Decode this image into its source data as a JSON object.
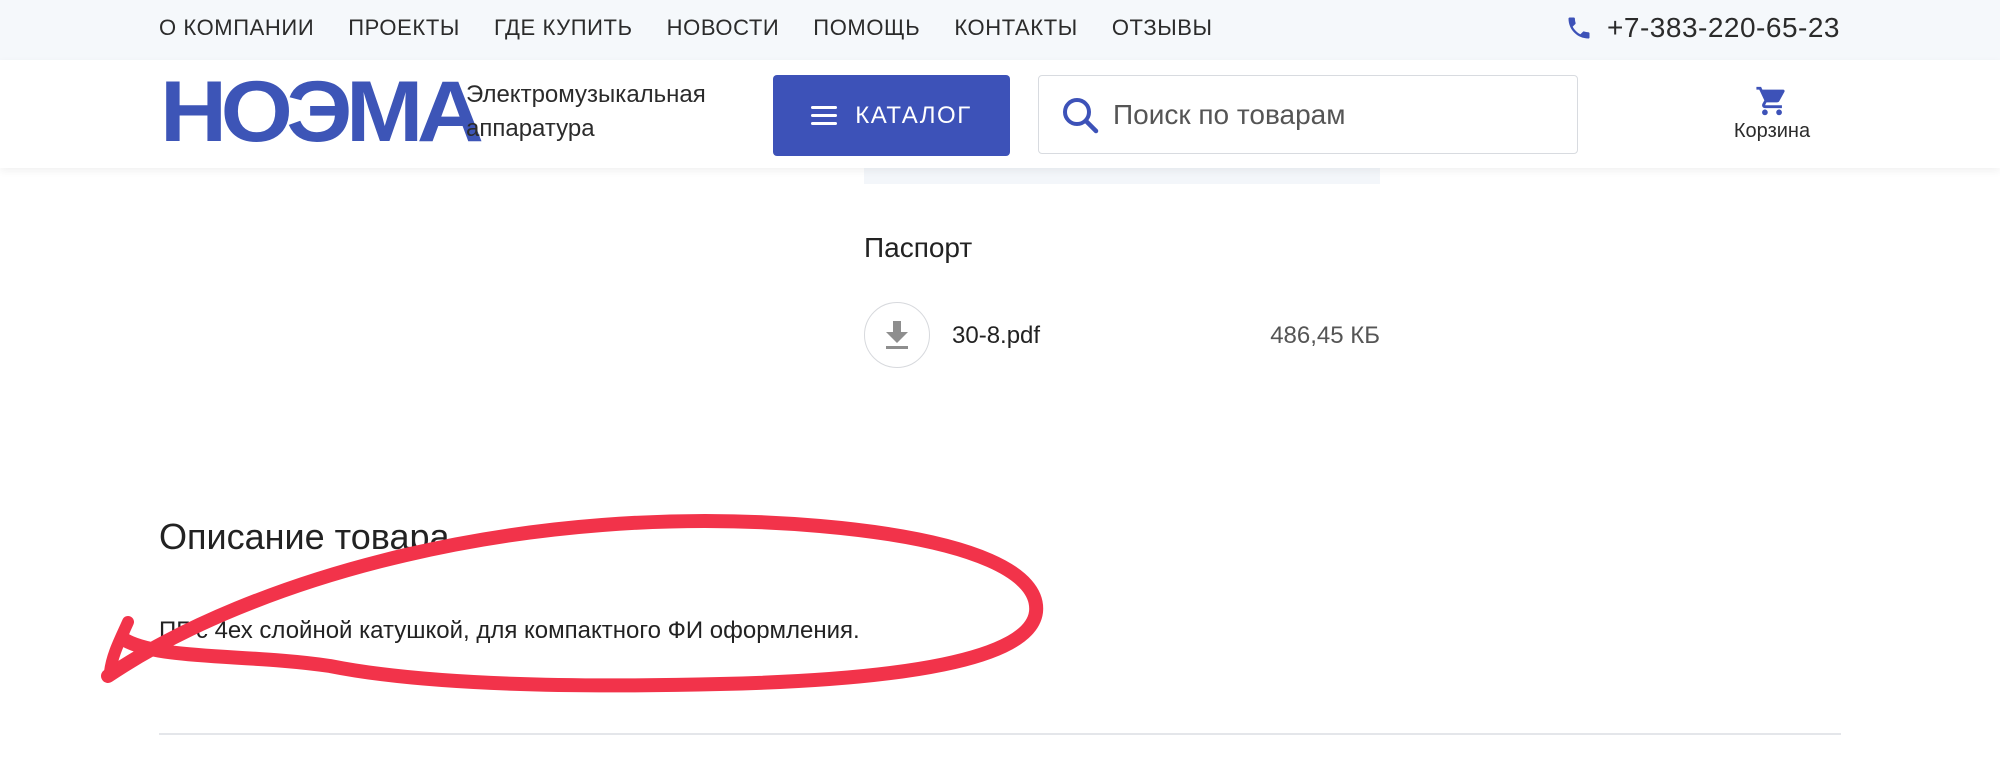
{
  "top_nav": {
    "items": [
      "О КОМПАНИИ",
      "ПРОЕКТЫ",
      "ГДЕ КУПИТЬ",
      "НОВОСТИ",
      "ПОМОЩЬ",
      "КОНТАКТЫ",
      "ОТЗЫВЫ"
    ],
    "phone": "+7-383-220-65-23"
  },
  "header": {
    "logo_text": "НОЭМА",
    "tagline_line1": "Электромузыкальная",
    "tagline_line2": "аппаратура",
    "catalog_label": "КАТАЛОГ",
    "search_placeholder": "Поиск по товарам",
    "cart_label": "Корзина"
  },
  "documents": {
    "section_title": "Паспорт",
    "files": [
      {
        "name": "30-8.pdf",
        "size": "486,45 КБ"
      }
    ]
  },
  "description": {
    "title": "Описание товара",
    "text": "ПГ с 4ех слойной катушкой, для компактного ФИ оформления."
  },
  "colors": {
    "brand_blue": "#3d52b8",
    "top_bar_bg": "#f5f8fb",
    "annotation_red": "#f2334a"
  }
}
